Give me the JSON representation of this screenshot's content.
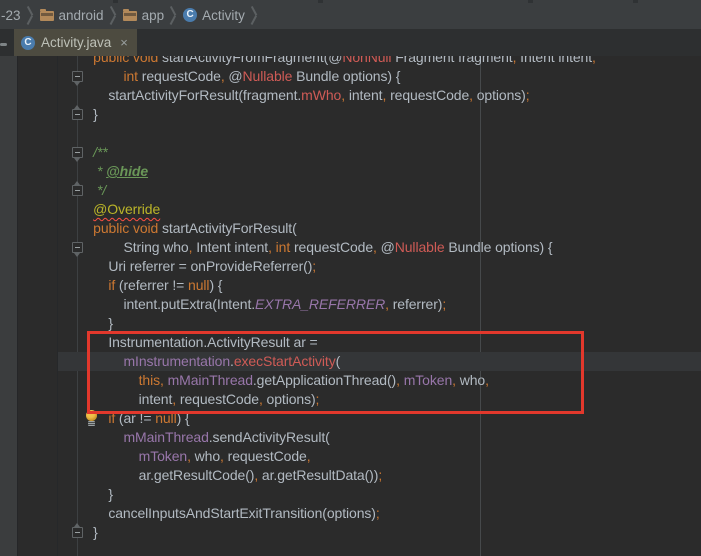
{
  "colors": {
    "editor-bg": "#2b2b2b",
    "default-text": "#b2bac2",
    "keyword": "#cc7832",
    "punctuation": "#cc7832",
    "error": "#cf5b56",
    "field": "#9876aa",
    "constant": "#9876aa",
    "comment": "#6a9758",
    "annotation-yellow": "#bbb529",
    "squiggle": "#ff4f43",
    "caret-row": "#343638",
    "annotation-red": "#e2382c",
    "margin-line": "#46494b",
    "fold-line": "#3d4042",
    "fold-marker": "#5f6365",
    "gutter-border": "#26282a",
    "frame-strip": "#3b3d3e",
    "breadcrumb-bg": "#3b3e40",
    "breadcrumb-text": "#a4abb0",
    "chevron": "#5c6062",
    "folder": "#b2895a",
    "class-icon-bg": "#4a7cad",
    "tabbar-bg": "#2d2f30",
    "tab-active-bg": "#4d4b40",
    "tab-text": "#bdc0b7",
    "bulb": "#f0c04a"
  },
  "chrome": {
    "breadcrumb_items": [
      {
        "label": "-23",
        "icon": "none"
      },
      {
        "label": "android",
        "icon": "folder"
      },
      {
        "label": "app",
        "icon": "folder"
      },
      {
        "label": "Activity",
        "icon": "class"
      }
    ],
    "class_letter": "C",
    "tab": {
      "label": "Activity.java",
      "close_glyph": "×"
    }
  },
  "editor": {
    "caret_line": 17,
    "bulb_line": 20,
    "fold_markers": [
      {
        "line": 2,
        "dir": "down"
      },
      {
        "line": 4,
        "dir": "up"
      },
      {
        "line": 6,
        "dir": "down"
      },
      {
        "line": 8,
        "dir": "up"
      },
      {
        "line": 11,
        "dir": "down"
      },
      {
        "line": 26,
        "dir": "up"
      }
    ],
    "annotation_box_lines": {
      "from": 16,
      "to": 19
    },
    "lines": [
      [
        [
          "    ",
          "d"
        ],
        [
          "public void ",
          "k"
        ],
        [
          "startActivityFromFragment(@",
          "d"
        ],
        [
          "NonNull",
          "e"
        ],
        [
          " Fragment fragment",
          "d"
        ],
        [
          ",",
          "p"
        ],
        [
          " Intent intent",
          "d"
        ],
        [
          ",",
          "p"
        ]
      ],
      [
        [
          "            ",
          "d"
        ],
        [
          "int",
          "k"
        ],
        [
          " requestCode",
          "d"
        ],
        [
          ",",
          "p"
        ],
        [
          " @",
          "d"
        ],
        [
          "Nullable",
          "e"
        ],
        [
          " Bundle options) {",
          "d"
        ]
      ],
      [
        [
          "        startActivityForResult(fragment.",
          "d"
        ],
        [
          "mWho",
          "e"
        ],
        [
          ",",
          "p"
        ],
        [
          " intent",
          "d"
        ],
        [
          ",",
          "p"
        ],
        [
          " requestCode",
          "d"
        ],
        [
          ",",
          "p"
        ],
        [
          " options)",
          "d"
        ],
        [
          ";",
          "p"
        ]
      ],
      [
        [
          "    }",
          "d"
        ]
      ],
      [],
      [
        [
          "    /**",
          "c"
        ]
      ],
      [
        [
          "     * ",
          "c"
        ],
        [
          "@hide",
          "ch"
        ]
      ],
      [
        [
          "     */",
          "c"
        ]
      ],
      [
        [
          "    ",
          "d"
        ],
        [
          "@Override",
          "aw"
        ]
      ],
      [
        [
          "    ",
          "d"
        ],
        [
          "public void ",
          "k"
        ],
        [
          "startActivityForResult(",
          "d"
        ]
      ],
      [
        [
          "            String who",
          "d"
        ],
        [
          ",",
          "p"
        ],
        [
          " Intent intent",
          "d"
        ],
        [
          ",",
          "p"
        ],
        [
          " ",
          "d"
        ],
        [
          "int",
          "k"
        ],
        [
          " requestCode",
          "d"
        ],
        [
          ",",
          "p"
        ],
        [
          " @",
          "d"
        ],
        [
          "Nullable",
          "e"
        ],
        [
          " Bundle options) {",
          "d"
        ]
      ],
      [
        [
          "        Uri referrer = onProvideReferrer()",
          "d"
        ],
        [
          ";",
          "p"
        ]
      ],
      [
        [
          "        ",
          "d"
        ],
        [
          "if",
          "k"
        ],
        [
          " (referrer != ",
          "d"
        ],
        [
          "null",
          "k"
        ],
        [
          ") {",
          "d"
        ]
      ],
      [
        [
          "            intent.putExtra(Intent.",
          "d"
        ],
        [
          "EXTRA_REFERRER",
          "sc"
        ],
        [
          ",",
          "p"
        ],
        [
          " referrer)",
          "d"
        ],
        [
          ";",
          "p"
        ]
      ],
      [
        [
          "        }",
          "d"
        ]
      ],
      [
        [
          "        Instrumentation.ActivityResult ar =",
          "d"
        ]
      ],
      [
        [
          "            ",
          "d"
        ],
        [
          "mInstrumentation",
          "f"
        ],
        [
          ".",
          "d"
        ],
        [
          "execStartActivity",
          "e"
        ],
        [
          "(",
          "d"
        ]
      ],
      [
        [
          "                ",
          "d"
        ],
        [
          "this",
          "k"
        ],
        [
          ",",
          "p"
        ],
        [
          " ",
          "d"
        ],
        [
          "mMainThread",
          "f"
        ],
        [
          ".getApplicationThread()",
          "d"
        ],
        [
          ",",
          "p"
        ],
        [
          " ",
          "d"
        ],
        [
          "mToken",
          "f"
        ],
        [
          ",",
          "p"
        ],
        [
          " who",
          "d"
        ],
        [
          ",",
          "p"
        ]
      ],
      [
        [
          "                intent",
          "d"
        ],
        [
          ",",
          "p"
        ],
        [
          " requestCode",
          "d"
        ],
        [
          ",",
          "p"
        ],
        [
          " options)",
          "d"
        ],
        [
          ";",
          "p"
        ]
      ],
      [
        [
          "        ",
          "d"
        ],
        [
          "if",
          "k"
        ],
        [
          " (ar != ",
          "d"
        ],
        [
          "null",
          "k"
        ],
        [
          ") {",
          "d"
        ]
      ],
      [
        [
          "            ",
          "d"
        ],
        [
          "mMainThread",
          "f"
        ],
        [
          ".sendActivityResult(",
          "d"
        ]
      ],
      [
        [
          "                ",
          "d"
        ],
        [
          "mToken",
          "f"
        ],
        [
          ",",
          "p"
        ],
        [
          " who",
          "d"
        ],
        [
          ",",
          "p"
        ],
        [
          " requestCode",
          "d"
        ],
        [
          ",",
          "p"
        ]
      ],
      [
        [
          "                ar.getResultCode()",
          "d"
        ],
        [
          ",",
          "p"
        ],
        [
          " ar.getResultData())",
          "d"
        ],
        [
          ";",
          "p"
        ]
      ],
      [
        [
          "        }",
          "d"
        ]
      ],
      [
        [
          "        cancelInputsAndStartExitTransition(options)",
          "d"
        ],
        [
          ";",
          "p"
        ]
      ],
      [
        [
          "    }",
          "d"
        ]
      ]
    ]
  }
}
